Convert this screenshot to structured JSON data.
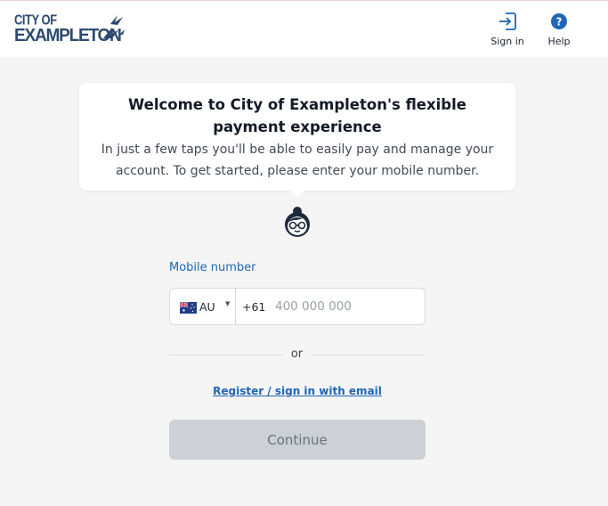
{
  "header": {
    "logo_line1": "CITY OF",
    "logo_line2": "EXAMPLETON",
    "signin_label": "Sign in",
    "help_label": "Help",
    "brand_color": "#2c4a72",
    "icon_color": "#1f66b6"
  },
  "welcome": {
    "title": "Welcome to City of Exampleton's flexible payment experience",
    "body": "In just a few taps you'll be able to easily pay and manage your account. To get started, please enter your mobile number."
  },
  "form": {
    "mobile_label": "Mobile number",
    "country_code": "AU",
    "country_flag": "australia-flag-icon",
    "dial_code": "+61",
    "phone_value": "",
    "phone_placeholder": "400 000 000",
    "or_text": "or",
    "email_link": "Register / sign in with email",
    "continue_label": "Continue",
    "continue_disabled": true
  },
  "colors": {
    "link": "#1f66b6",
    "button_disabled_bg": "#cdd0d6",
    "button_disabled_text": "#6b717a"
  }
}
